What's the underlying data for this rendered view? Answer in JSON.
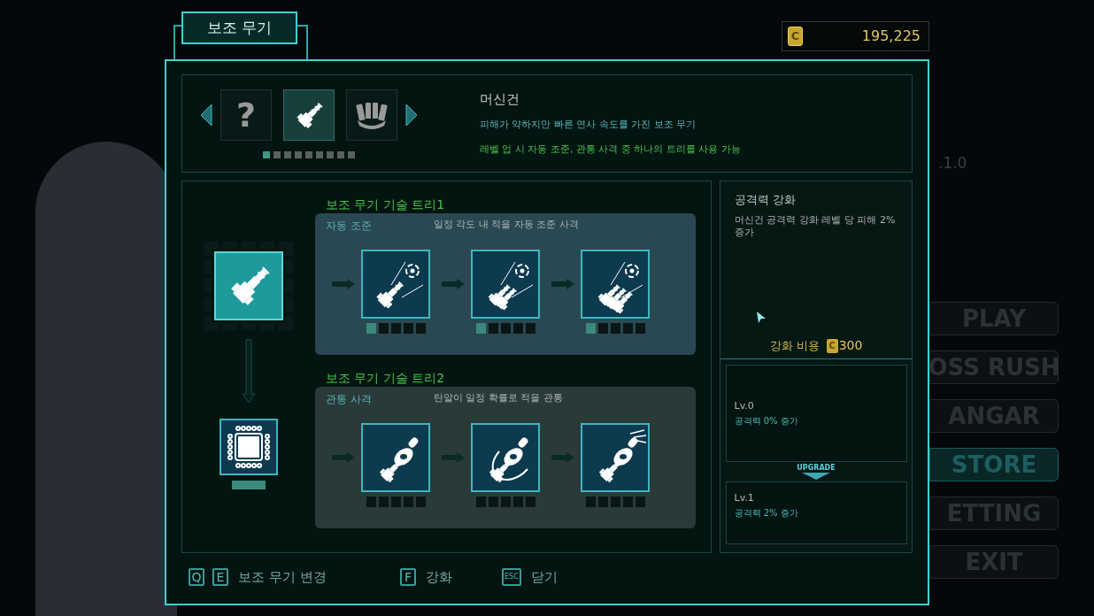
{
  "tab_title": "보조 무기",
  "currency": {
    "symbol": "C",
    "amount": "195,225"
  },
  "version": ".1.0",
  "background_menu": [
    {
      "label": "PLAY",
      "selected": false
    },
    {
      "label": "OSS RUSH",
      "selected": false
    },
    {
      "label": "ANGAR",
      "selected": false
    },
    {
      "label": "STORE",
      "selected": true
    },
    {
      "label": "ETTING",
      "selected": false
    },
    {
      "label": "EXIT",
      "selected": false
    }
  ],
  "weapon_selector": {
    "slots": [
      {
        "kind": "unknown",
        "label": "?",
        "selected": false
      },
      {
        "kind": "machinegun",
        "selected": true
      },
      {
        "kind": "fist",
        "selected": false
      }
    ],
    "pages": [
      {
        "selected": true
      },
      {
        "selected": false
      },
      {
        "selected": false
      },
      {
        "selected": false
      },
      {
        "selected": false
      },
      {
        "selected": false
      },
      {
        "selected": false
      },
      {
        "selected": false
      },
      {
        "selected": false
      }
    ]
  },
  "weapon": {
    "name": "머신건",
    "description": "피해가 약하지만 빠른 연사 속도를 가진 보조 무기",
    "note": "레벨 업 시 자동 조준, 관통 사격 중 하나의 트리를 사용 가능"
  },
  "trees": [
    {
      "title": "보조 무기 기술 트리1",
      "name": "자동 조준",
      "description": "일정 각도 내 적을 자동 조준 사격",
      "selected": true,
      "nodes": [
        {
          "kind": "aim-single",
          "pips": [
            {
              "on": true
            },
            {
              "on": false
            },
            {
              "on": false
            },
            {
              "on": false
            },
            {
              "on": false
            }
          ]
        },
        {
          "kind": "aim-double",
          "pips": [
            {
              "on": true
            },
            {
              "on": false
            },
            {
              "on": false
            },
            {
              "on": false
            },
            {
              "on": false
            }
          ]
        },
        {
          "kind": "aim-triple",
          "pips": [
            {
              "on": true
            },
            {
              "on": false
            },
            {
              "on": false
            },
            {
              "on": false
            },
            {
              "on": false
            }
          ]
        }
      ]
    },
    {
      "title": "보조 무기 기술 트리2",
      "name": "관통 사격",
      "description": "탄알이 일정 확률로 적을 관통",
      "selected": false,
      "nodes": [
        {
          "kind": "pierce",
          "pips": [
            {
              "on": false
            },
            {
              "on": false
            },
            {
              "on": false
            },
            {
              "on": false
            },
            {
              "on": false
            }
          ]
        },
        {
          "kind": "pierce-wave",
          "pips": [
            {
              "on": false
            },
            {
              "on": false
            },
            {
              "on": false
            },
            {
              "on": false
            },
            {
              "on": false
            }
          ]
        },
        {
          "kind": "pierce-burst",
          "pips": [
            {
              "on": false
            },
            {
              "on": false
            },
            {
              "on": false
            },
            {
              "on": false
            },
            {
              "on": false
            }
          ]
        }
      ]
    }
  ],
  "upgrade": {
    "title": "공격력 강화",
    "description": "머신건 공격력 강화 레벨 당 피해 2% 증가",
    "cost_label": "강화 비용",
    "coin": "C",
    "cost": "300",
    "upgrade_label": "UPGRADE",
    "levels": [
      {
        "level": "Lv.0",
        "effect": "공격력 0% 증가"
      },
      {
        "level": "Lv.1",
        "effect": "공격력 2% 증가"
      }
    ]
  },
  "hints": [
    {
      "keys": [
        "Q",
        "E"
      ],
      "label": "보조 무기 변경"
    },
    {
      "keys": [
        "F"
      ],
      "label": "강화"
    },
    {
      "keys": [
        "ESC"
      ],
      "label": "닫기"
    }
  ]
}
